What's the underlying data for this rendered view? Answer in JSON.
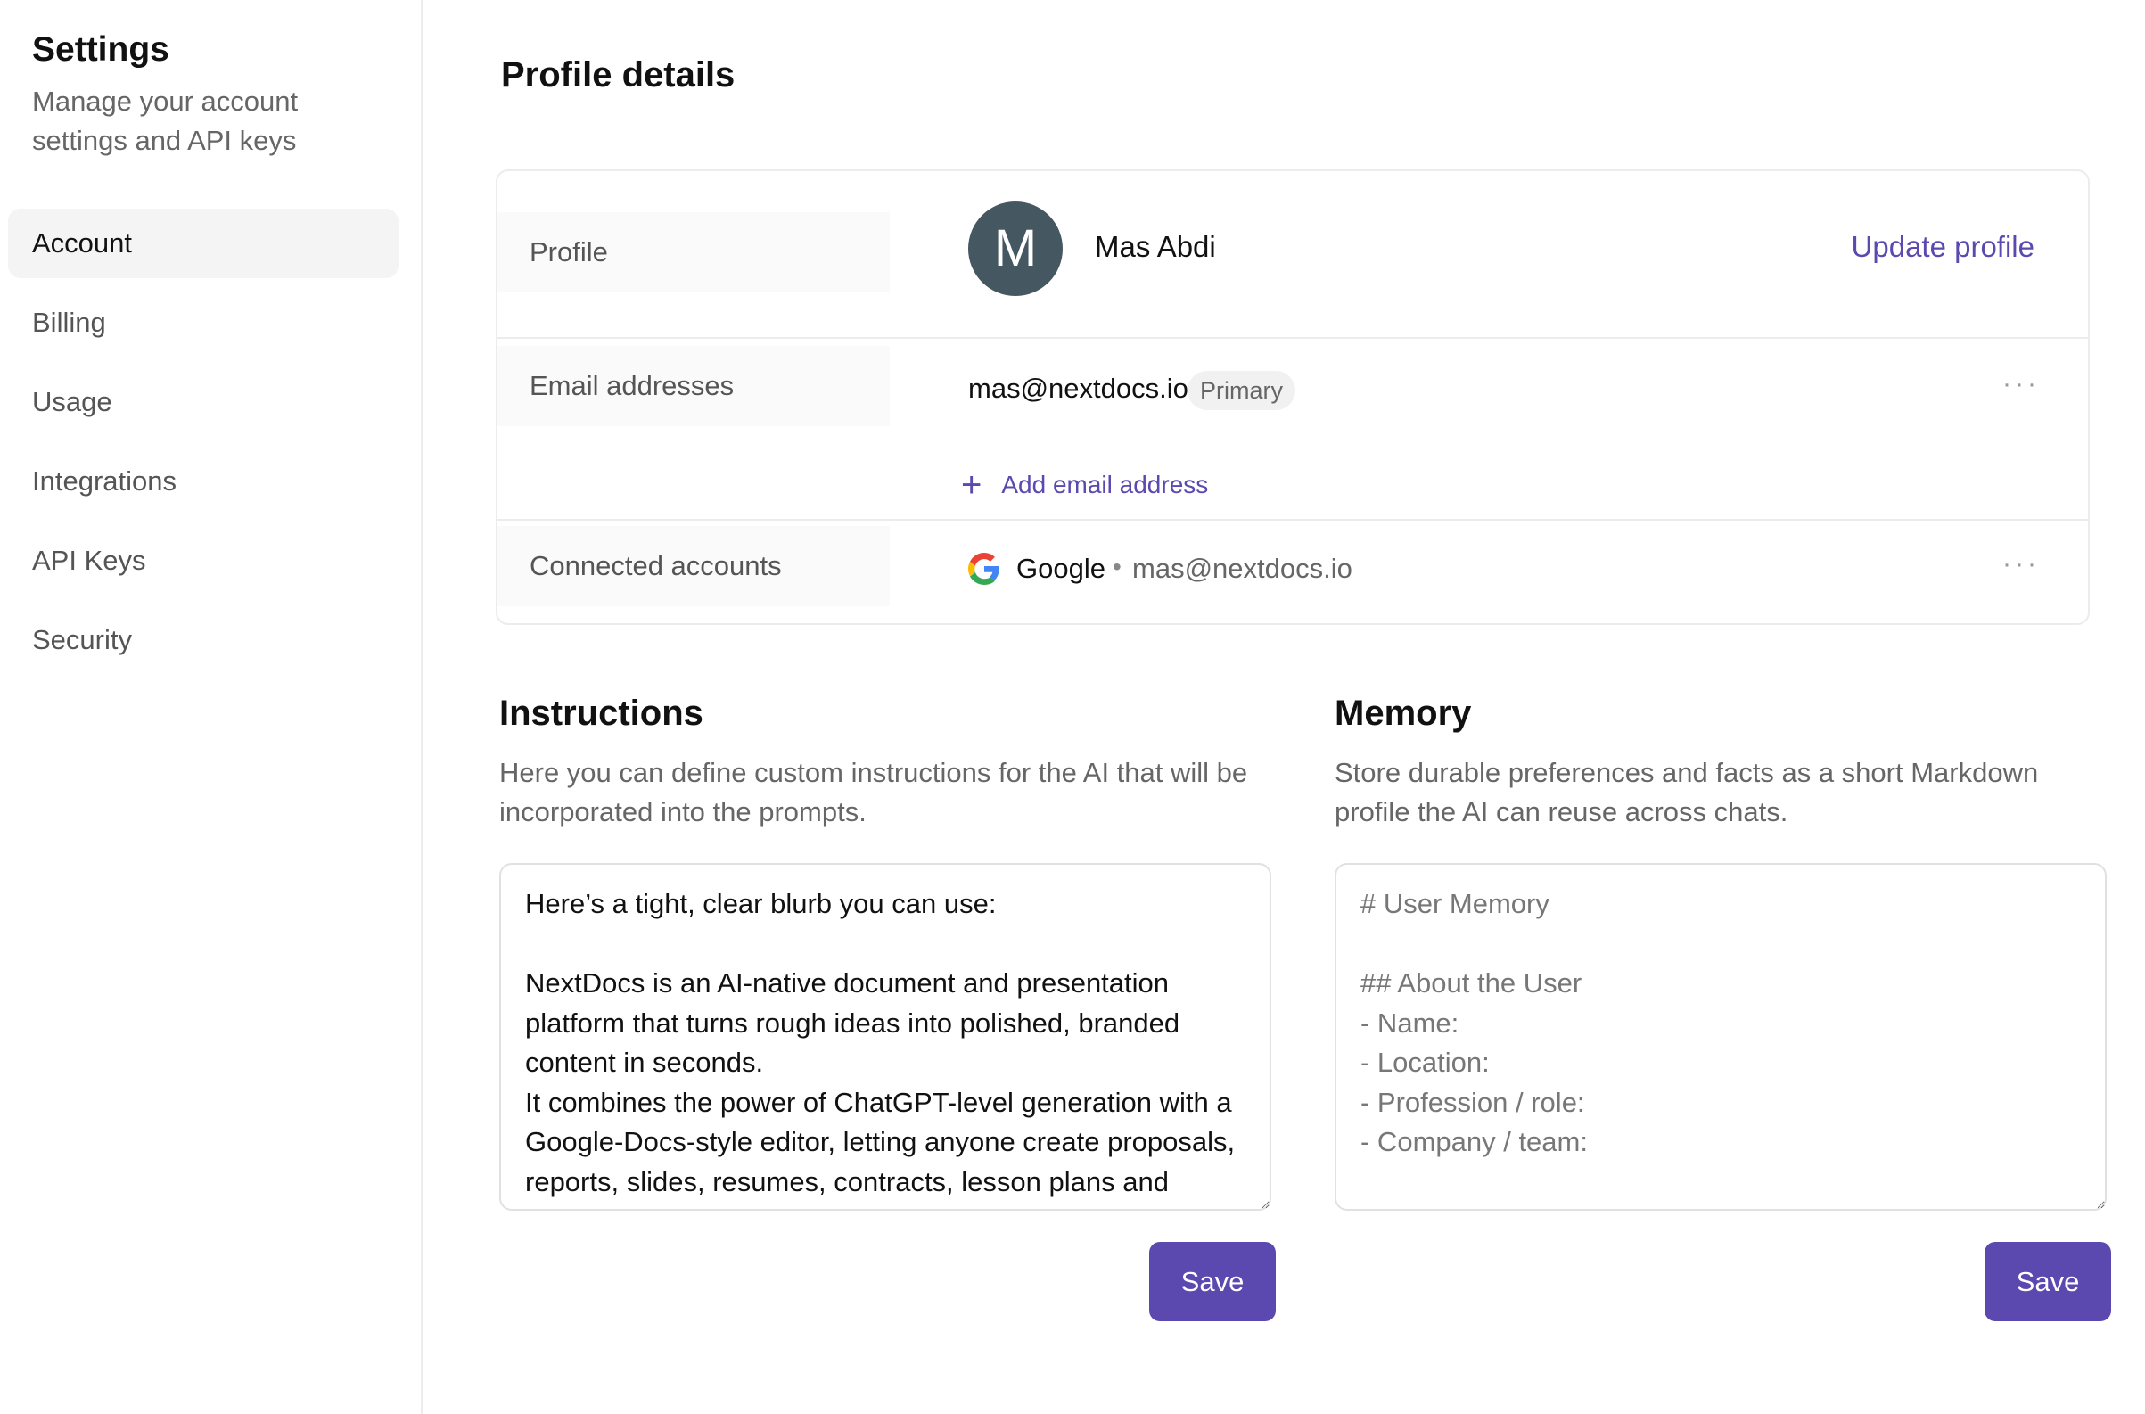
{
  "sidebar": {
    "title": "Settings",
    "subtitle": "Manage your account settings and API keys",
    "items": [
      {
        "label": "Account",
        "active": true
      },
      {
        "label": "Billing"
      },
      {
        "label": "Usage"
      },
      {
        "label": "Integrations"
      },
      {
        "label": "API Keys"
      },
      {
        "label": "Security"
      }
    ]
  },
  "main": {
    "title": "Profile details",
    "profile": {
      "label": "Profile",
      "avatar_initial": "M",
      "name": "Mas Abdi",
      "update_label": "Update profile"
    },
    "emails": {
      "label": "Email addresses",
      "address": "mas@nextdocs.io",
      "badge": "Primary",
      "more": "···",
      "add_plus": "+",
      "add_label": "Add email address"
    },
    "connected": {
      "label": "Connected accounts",
      "provider": "Google",
      "separator": "•",
      "email": "mas@nextdocs.io",
      "more": "···"
    }
  },
  "instructions": {
    "title": "Instructions",
    "description": "Here you can define custom instructions for the AI that will be incorporated into the prompts.",
    "text": "Here’s a tight, clear blurb you can use:\n\nNextDocs is an AI-native document and presentation platform that turns rough ideas into polished, branded content in seconds.\nIt combines the power of ChatGPT-level generation with a Google-Docs-style editor, letting anyone create proposals, reports, slides, resumes, contracts, lesson plans and more, instantly formatted, styled and ready to share.",
    "save_label": "Save"
  },
  "memory": {
    "title": "Memory",
    "description": "Store durable preferences and facts as a short Markdown profile the AI can reuse across chats.",
    "text": "# User Memory\n\n## About the User\n- Name:\n- Location:\n- Profession / role:\n- Company / team:\n\n## Work Context",
    "save_label": "Save"
  },
  "colors": {
    "accent": "#5b49b0",
    "avatar_bg": "#455760"
  }
}
